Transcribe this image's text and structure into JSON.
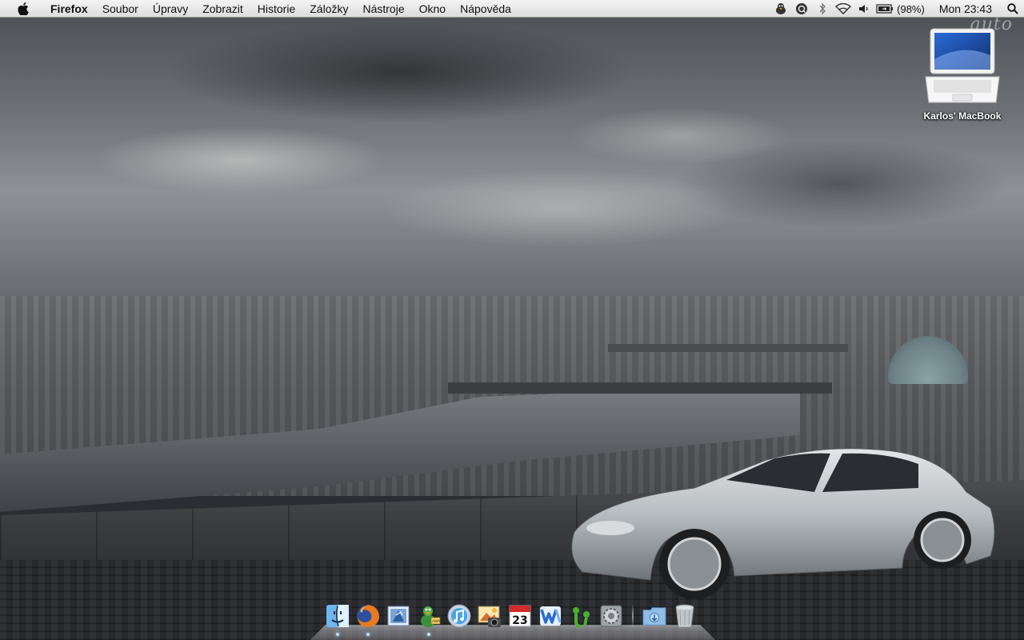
{
  "menubar": {
    "apple_icon": "apple-logo-icon",
    "app_name": "Firefox",
    "items": [
      "Soubor",
      "Úpravy",
      "Zobrazit",
      "Historie",
      "Záložky",
      "Nástroje",
      "Okno",
      "Nápověda"
    ],
    "status": {
      "battery_percent": "(98%)",
      "clock": "Mon 23:43",
      "icons": [
        "adium-icon",
        "quicksilver-icon",
        "bluetooth-icon",
        "wifi-icon",
        "volume-icon",
        "battery-icon",
        "spotlight-icon"
      ]
    }
  },
  "desktop": {
    "watermark": "auto",
    "icons": [
      {
        "label": "Karlos' MacBook",
        "icon": "macbook-icon"
      }
    ]
  },
  "dock": {
    "apps": [
      {
        "name": "Finder",
        "icon": "finder-icon",
        "running": true
      },
      {
        "name": "Firefox",
        "icon": "firefox-icon",
        "running": true
      },
      {
        "name": "Mail",
        "icon": "mail-icon",
        "running": false
      },
      {
        "name": "Adium",
        "icon": "adium-duck-icon",
        "running": true
      },
      {
        "name": "iTunes",
        "icon": "itunes-icon",
        "running": false
      },
      {
        "name": "iPhoto",
        "icon": "iphoto-icon",
        "running": false
      },
      {
        "name": "iCal",
        "icon": "ical-icon",
        "running": false,
        "date": "23"
      },
      {
        "name": "Word",
        "icon": "word-icon",
        "running": false
      },
      {
        "name": "Yahoo Messenger",
        "icon": "messenger-icon",
        "running": false
      },
      {
        "name": "System Preferences",
        "icon": "system-preferences-icon",
        "running": false
      }
    ],
    "stacks": [
      {
        "name": "Downloads",
        "icon": "downloads-folder-icon"
      },
      {
        "name": "Trash",
        "icon": "trash-icon"
      }
    ]
  },
  "colors": {
    "menubar_bg": "#e6e6e6",
    "menu_text": "#111111",
    "desktop_label": "#ffffff",
    "car_silver": "#b7bcc0"
  }
}
